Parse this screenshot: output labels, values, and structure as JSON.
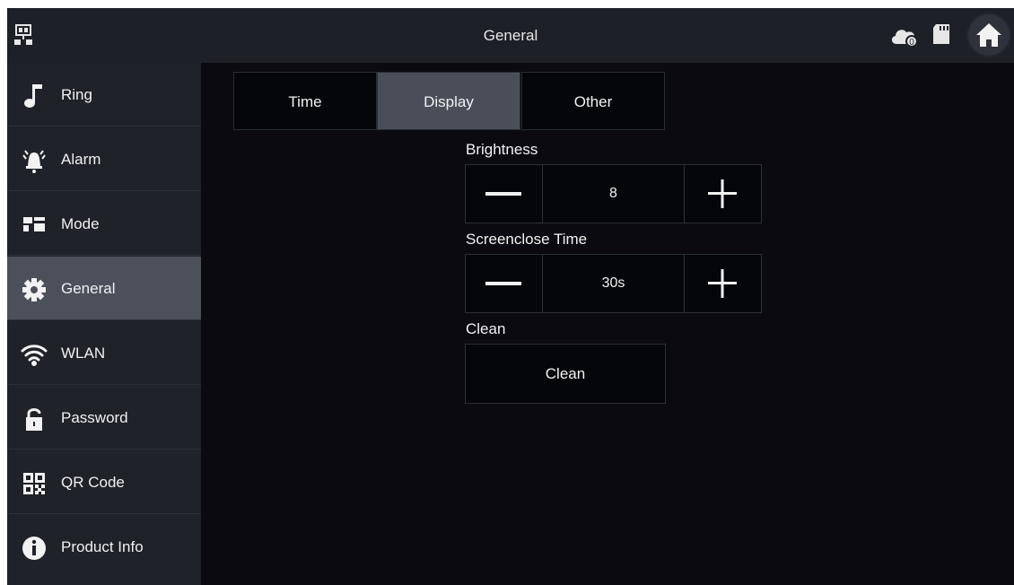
{
  "topbar": {
    "title": "General",
    "icons": [
      "network-icon",
      "cloud-icon",
      "sd-card-icon",
      "home-icon"
    ]
  },
  "sidebar": {
    "items": [
      {
        "label": "Ring",
        "icon": "music-note-icon"
      },
      {
        "label": "Alarm",
        "icon": "alarm-bell-icon"
      },
      {
        "label": "Mode",
        "icon": "mode-grid-icon"
      },
      {
        "label": "General",
        "icon": "gear-icon",
        "active": true
      },
      {
        "label": "WLAN",
        "icon": "wifi-icon"
      },
      {
        "label": "Password",
        "icon": "lock-icon"
      },
      {
        "label": "QR Code",
        "icon": "qr-code-icon"
      },
      {
        "label": "Product Info",
        "icon": "info-icon"
      }
    ]
  },
  "tabs": [
    {
      "label": "Time"
    },
    {
      "label": "Display",
      "active": true
    },
    {
      "label": "Other"
    }
  ],
  "brightness": {
    "label": "Brightness",
    "value": "8"
  },
  "screenclose": {
    "label": "Screenclose Time",
    "value": "30s"
  },
  "clean": {
    "label": "Clean",
    "button_label": "Clean"
  },
  "colors": {
    "background": "#0a0a10",
    "bar": "#1e2028",
    "active": "#4c505a"
  }
}
